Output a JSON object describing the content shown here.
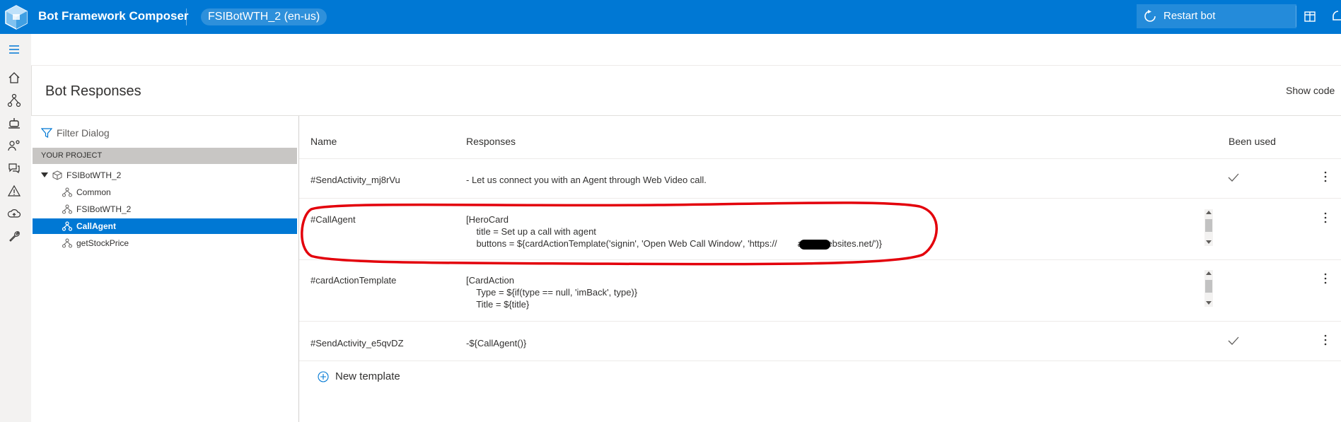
{
  "app": {
    "title": "Bot Framework Composer",
    "project": "FSIBotWTH_2 (en-us)"
  },
  "header_actions": {
    "restart_label": "Restart bot"
  },
  "page": {
    "title": "Bot Responses",
    "show_code": "Show code"
  },
  "tree": {
    "filter_placeholder": "Filter Dialog",
    "section_label": "YOUR PROJECT",
    "root": "FSIBotWTH_2",
    "items": [
      {
        "label": "Common",
        "selected": false
      },
      {
        "label": "FSIBotWTH_2",
        "selected": false
      },
      {
        "label": "CallAgent",
        "selected": true
      },
      {
        "label": "getStockPrice",
        "selected": false
      }
    ]
  },
  "table": {
    "columns": {
      "name": "Name",
      "responses": "Responses",
      "used": "Been used"
    },
    "rows": [
      {
        "name": "#SendActivity_mj8rVu",
        "responses": "- Let us connect you with an Agent through Web Video call.",
        "used": true
      },
      {
        "name": "#CallAgent",
        "responses": "[HeroCard\n    title = Set up a call with agent\n    buttons = ${cardActionTemplate('signin', 'Open Web Call Window', 'https://        azurewebsites.net/')}",
        "used": false
      },
      {
        "name": "#cardActionTemplate",
        "responses": "[CardAction\n    Type = ${if(type == null, 'imBack', type)}\n    Title = ${title}",
        "used": false
      },
      {
        "name": "#SendActivity_e5qvDZ",
        "responses": "-${CallAgent()}",
        "used": true
      }
    ],
    "new_template_label": "New template"
  },
  "colors": {
    "accent": "#0078d4",
    "annotation": "#e3000b"
  }
}
